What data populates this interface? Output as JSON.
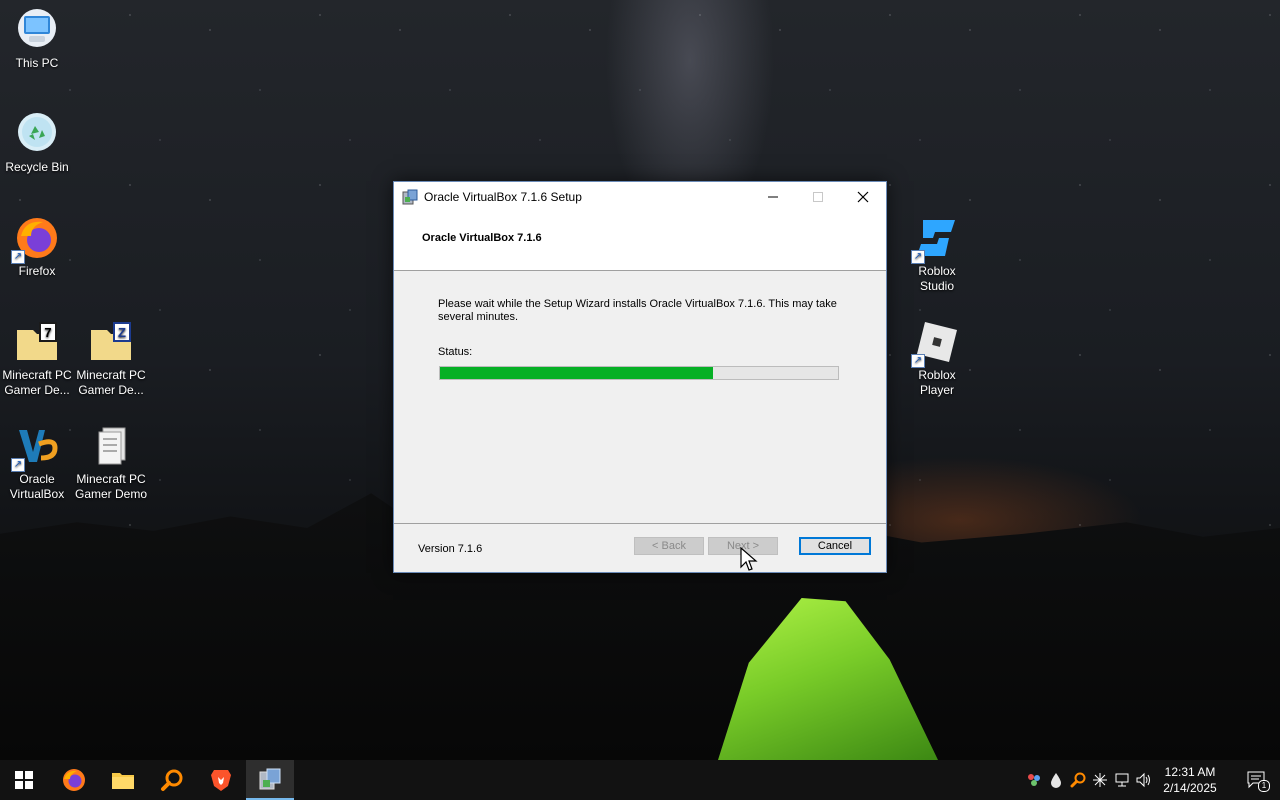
{
  "desktop": {
    "icons": [
      {
        "label": "This PC"
      },
      {
        "label": "Recycle Bin"
      },
      {
        "label": "Firefox"
      },
      {
        "label": "Minecraft PC Gamer De..."
      },
      {
        "label": "Minecraft PC Gamer De..."
      },
      {
        "label": "Oracle VirtualBox"
      },
      {
        "label": "Minecraft PC Gamer Demo"
      },
      {
        "label": "Roblox Studio"
      },
      {
        "label": "Roblox Player"
      }
    ]
  },
  "dialog": {
    "window_title": "Oracle VirtualBox 7.1.6 Setup",
    "header_title": "Oracle VirtualBox 7.1.6",
    "message": "Please wait while the Setup Wizard installs Oracle VirtualBox 7.1.6. This may take several minutes.",
    "status_label": "Status:",
    "progress_fraction": 0.685,
    "version_text": "Version 7.1.6",
    "back_label": "< Back",
    "next_label": "Next >",
    "cancel_label": "Cancel",
    "progress_color": "#06b025"
  },
  "taskbar": {
    "items": [
      {
        "icon": "windows-start-icon"
      },
      {
        "icon": "firefox-icon"
      },
      {
        "icon": "file-explorer-icon"
      },
      {
        "icon": "search-magnifier-icon"
      },
      {
        "icon": "brave-icon"
      },
      {
        "icon": "installer-icon",
        "active": true
      }
    ],
    "clock_time": "12:31 AM",
    "clock_date": "2/14/2025",
    "notification_count": "1"
  }
}
